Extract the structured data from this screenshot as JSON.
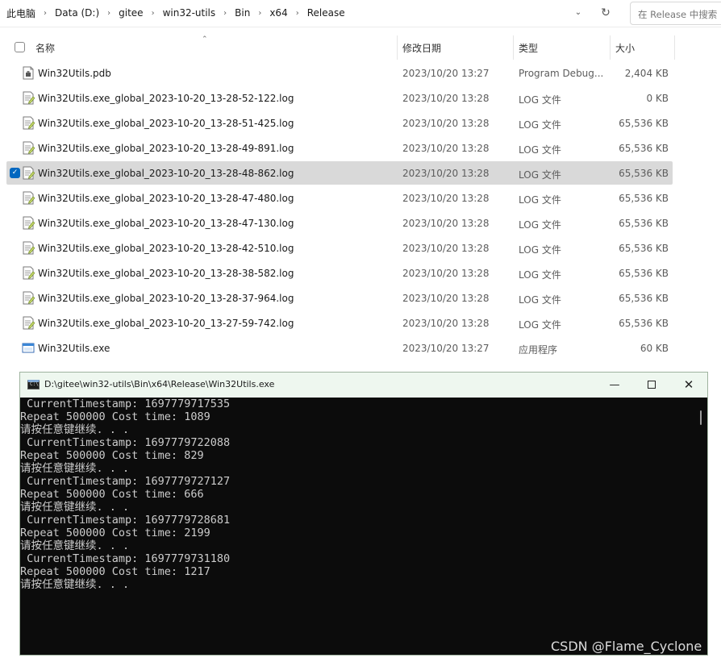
{
  "breadcrumbs": [
    "此电脑",
    "Data (D:)",
    "gitee",
    "win32-utils",
    "Bin",
    "x64",
    "Release"
  ],
  "search": {
    "placeholder": "在 Release 中搜索"
  },
  "columns": {
    "name": "名称",
    "date": "修改日期",
    "type": "类型",
    "size": "大小"
  },
  "files": [
    {
      "icon": "pdb-file-icon",
      "name": "Win32Utils.pdb",
      "date": "2023/10/20 13:27",
      "type": "Program Debug...",
      "size": "2,404 KB"
    },
    {
      "icon": "log-file-icon",
      "name": "Win32Utils.exe_global_2023-10-20_13-28-52-122.log",
      "date": "2023/10/20 13:28",
      "type": "LOG 文件",
      "size": "0 KB"
    },
    {
      "icon": "log-file-icon",
      "name": "Win32Utils.exe_global_2023-10-20_13-28-51-425.log",
      "date": "2023/10/20 13:28",
      "type": "LOG 文件",
      "size": "65,536 KB"
    },
    {
      "icon": "log-file-icon",
      "name": "Win32Utils.exe_global_2023-10-20_13-28-49-891.log",
      "date": "2023/10/20 13:28",
      "type": "LOG 文件",
      "size": "65,536 KB"
    },
    {
      "icon": "log-file-icon",
      "name": "Win32Utils.exe_global_2023-10-20_13-28-48-862.log",
      "date": "2023/10/20 13:28",
      "type": "LOG 文件",
      "size": "65,536 KB",
      "selected": true
    },
    {
      "icon": "log-file-icon",
      "name": "Win32Utils.exe_global_2023-10-20_13-28-47-480.log",
      "date": "2023/10/20 13:28",
      "type": "LOG 文件",
      "size": "65,536 KB"
    },
    {
      "icon": "log-file-icon",
      "name": "Win32Utils.exe_global_2023-10-20_13-28-47-130.log",
      "date": "2023/10/20 13:28",
      "type": "LOG 文件",
      "size": "65,536 KB"
    },
    {
      "icon": "log-file-icon",
      "name": "Win32Utils.exe_global_2023-10-20_13-28-42-510.log",
      "date": "2023/10/20 13:28",
      "type": "LOG 文件",
      "size": "65,536 KB"
    },
    {
      "icon": "log-file-icon",
      "name": "Win32Utils.exe_global_2023-10-20_13-28-38-582.log",
      "date": "2023/10/20 13:28",
      "type": "LOG 文件",
      "size": "65,536 KB"
    },
    {
      "icon": "log-file-icon",
      "name": "Win32Utils.exe_global_2023-10-20_13-28-37-964.log",
      "date": "2023/10/20 13:28",
      "type": "LOG 文件",
      "size": "65,536 KB"
    },
    {
      "icon": "log-file-icon",
      "name": "Win32Utils.exe_global_2023-10-20_13-27-59-742.log",
      "date": "2023/10/20 13:28",
      "type": "LOG 文件",
      "size": "65,536 KB"
    },
    {
      "icon": "exe-file-icon",
      "name": "Win32Utils.exe",
      "date": "2023/10/20 13:27",
      "type": "应用程序",
      "size": "60 KB"
    }
  ],
  "console": {
    "title": "D:\\gitee\\win32-utils\\Bin\\x64\\Release\\Win32Utils.exe",
    "lines": [
      " CurrentTimestamp: 1697779717535",
      "Repeat 500000 Cost time: 1089",
      "请按任意键继续. . .",
      " CurrentTimestamp: 1697779722088",
      "Repeat 500000 Cost time: 829",
      "请按任意键继续. . .",
      " CurrentTimestamp: 1697779727127",
      "Repeat 500000 Cost time: 666",
      "请按任意键继续. . .",
      " CurrentTimestamp: 1697779728681",
      "Repeat 500000 Cost time: 2199",
      "请按任意键继续. . .",
      " CurrentTimestamp: 1697779731180",
      "Repeat 500000 Cost time: 1217",
      "请按任意键继续. . ."
    ]
  },
  "watermark": "CSDN @Flame_Cyclone"
}
